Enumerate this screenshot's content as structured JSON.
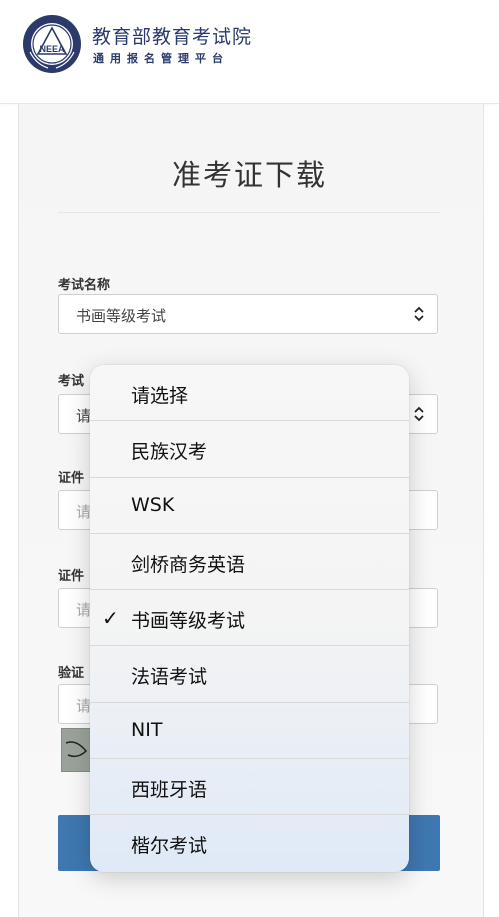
{
  "header": {
    "title": "教育部教育考试院",
    "subtitle": "通用报名管理平台"
  },
  "page": {
    "title": "准考证下载"
  },
  "form": {
    "exam_name": {
      "label": "考试名称",
      "value": "书画等级考试"
    },
    "exam_session": {
      "label": "考试",
      "placeholder": "请"
    },
    "id_type": {
      "label": "证件",
      "placeholder": "请"
    },
    "id_number": {
      "label": "证件",
      "placeholder": "请"
    },
    "captcha": {
      "label": "验证",
      "placeholder": "请"
    }
  },
  "dropdown": {
    "selected_index": 4,
    "options": [
      "请选择",
      "民族汉考",
      "WSK",
      "剑桥商务英语",
      "书画等级考试",
      "法语考试",
      "NIT",
      "西班牙语",
      "楷尔考试"
    ],
    "check_mark": "✓"
  },
  "colors": {
    "brand_blue": "#2b3a6b",
    "button_blue": "#3f77b0"
  }
}
